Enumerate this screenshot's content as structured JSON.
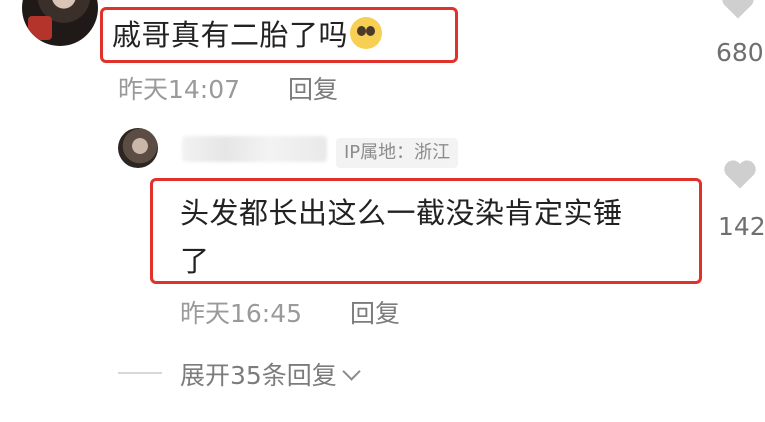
{
  "comments": [
    {
      "text": "戚哥真有二胎了吗",
      "emoji": "pleading-face-emoji",
      "time": "昨天14:07",
      "reply_label": "回复",
      "likes": "680"
    }
  ],
  "reply": {
    "ip_label": "IP属地：浙江",
    "text_line1": "头发都长出这么一截没染肯定实锤",
    "text_line2": "了",
    "time": "昨天16:45",
    "reply_label": "回复",
    "likes": "142"
  },
  "expand_label": "展开35条回复",
  "colors": {
    "highlight_box": "#e0322a",
    "meta_text": "#9a9a9a"
  }
}
